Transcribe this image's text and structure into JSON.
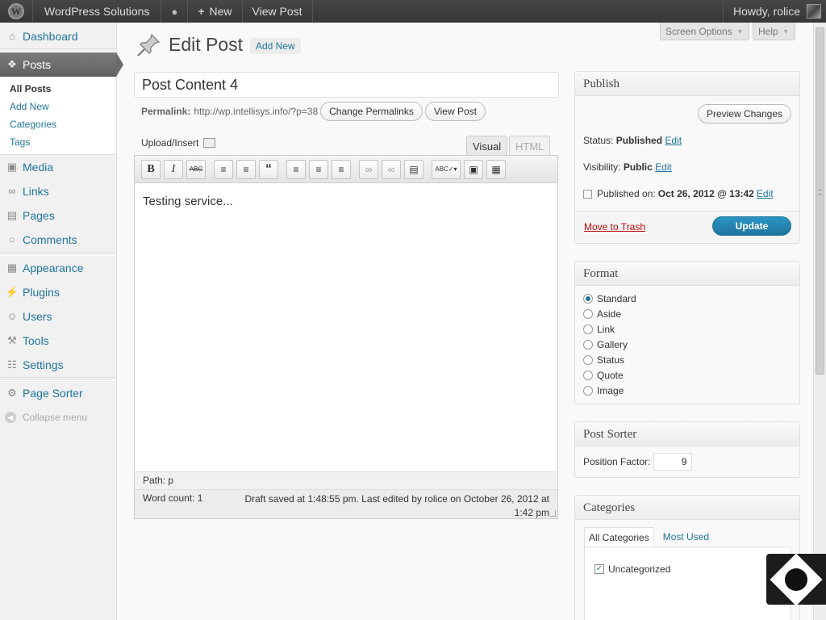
{
  "adminbar": {
    "site_name": "WordPress Solutions",
    "new_label": "New",
    "view_post": "View Post",
    "howdy": "Howdy, rolice"
  },
  "sidebar": {
    "dashboard": "Dashboard",
    "posts": "Posts",
    "posts_sub": [
      "All Posts",
      "Add New",
      "Categories",
      "Tags"
    ],
    "media": "Media",
    "links": "Links",
    "pages": "Pages",
    "comments": "Comments",
    "appearance": "Appearance",
    "plugins": "Plugins",
    "users": "Users",
    "tools": "Tools",
    "settings": "Settings",
    "page_sorter": "Page Sorter",
    "collapse": "Collapse menu"
  },
  "screen_options": "Screen Options",
  "help": "Help",
  "page": {
    "title": "Edit Post",
    "add_new": "Add New"
  },
  "post": {
    "title": "Post Content 4",
    "permalink_label": "Permalink:",
    "permalink_url": "http://wp.intellisys.info/?p=38",
    "change_permalinks": "Change Permalinks",
    "view_post": "View Post",
    "upload_insert": "Upload/Insert",
    "tab_visual": "Visual",
    "tab_html": "HTML",
    "content": "Testing service...",
    "path": "Path: p",
    "word_count": "Word count: 1",
    "draft_saved": "Draft saved at 1:48:55 pm. Last edited by rolice on October 26, 2012 at 1:42 pm"
  },
  "publish": {
    "heading": "Publish",
    "preview": "Preview Changes",
    "status_label": "Status:",
    "status_value": "Published",
    "visibility_label": "Visibility:",
    "visibility_value": "Public",
    "published_label": "Published on:",
    "published_value": "Oct 26, 2012 @ 13:42",
    "edit": "Edit",
    "trash": "Move to Trash",
    "update": "Update"
  },
  "format": {
    "heading": "Format",
    "options": [
      "Standard",
      "Aside",
      "Link",
      "Gallery",
      "Status",
      "Quote",
      "Image"
    ],
    "selected": "Standard"
  },
  "post_sorter": {
    "heading": "Post Sorter",
    "label": "Position Factor:",
    "value": "9"
  },
  "categories": {
    "heading": "Categories",
    "tab_all": "All Categories",
    "tab_used": "Most Used",
    "items": [
      {
        "label": "Uncategorized",
        "checked": true
      }
    ]
  },
  "colors": {
    "link": "#21759b",
    "adminbar": "#464646",
    "primary_button": "#21759b",
    "trash": "#bc0b0b"
  }
}
